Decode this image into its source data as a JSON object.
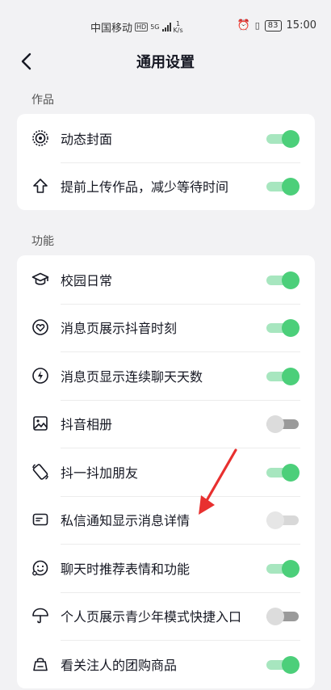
{
  "status_bar": {
    "carrier": "中国移动",
    "hd": "HD",
    "network": "5G",
    "speed_value": "1",
    "speed_unit": "K/s",
    "battery": "83",
    "time": "15:00"
  },
  "header": {
    "title": "通用设置"
  },
  "sections": [
    {
      "label": "作品",
      "items": [
        {
          "label": "动态封面",
          "icon": "live-cover-icon",
          "toggle": "on"
        },
        {
          "label": "提前上传作品，减少等待时间",
          "icon": "upload-icon",
          "toggle": "on"
        }
      ]
    },
    {
      "label": "功能",
      "items": [
        {
          "label": "校园日常",
          "icon": "graduation-cap-icon",
          "toggle": "on"
        },
        {
          "label": "消息页展示抖音时刻",
          "icon": "moments-heart-icon",
          "toggle": "on"
        },
        {
          "label": "消息页显示连续聊天天数",
          "icon": "flame-icon",
          "toggle": "on"
        },
        {
          "label": "抖音相册",
          "icon": "album-icon",
          "toggle": "off"
        },
        {
          "label": "抖一抖加朋友",
          "icon": "shake-phone-icon",
          "toggle": "on"
        },
        {
          "label": "私信通知显示消息详情",
          "icon": "message-card-icon",
          "toggle": "disabled"
        },
        {
          "label": "聊天时推荐表情和功能",
          "icon": "emoji-icon",
          "toggle": "on"
        },
        {
          "label": "个人页展示青少年模式快捷入口",
          "icon": "umbrella-icon",
          "toggle": "off"
        },
        {
          "label": "看关注人的团购商品",
          "icon": "shopping-bag-icon",
          "toggle": "on"
        }
      ]
    }
  ],
  "colors": {
    "toggle_on": "#4ccf7a",
    "annotation_arrow": "#e8302f"
  }
}
